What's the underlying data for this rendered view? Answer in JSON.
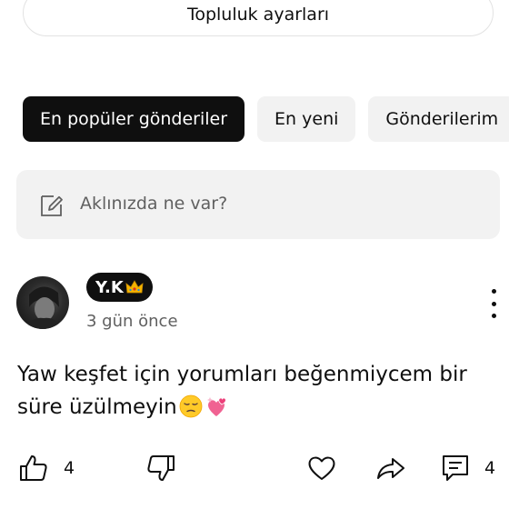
{
  "community_settings": {
    "label": "Topluluk ayarları"
  },
  "tabs": [
    {
      "label": "En popüler gönderiler",
      "active": true
    },
    {
      "label": "En yeni",
      "active": false
    },
    {
      "label": "Gönderilerim",
      "active": false
    }
  ],
  "composer": {
    "placeholder": "Aklınızda ne var?",
    "icon": "edit-icon"
  },
  "post": {
    "author": "Y.K",
    "author_badge_icon": "crown-emoji",
    "time": "3 gün önce",
    "text": "Yaw keşfet için yorumları beğenmiycem bir süre üzülmeyin",
    "emojis": [
      "pensive-face-emoji",
      "two-hearts-emoji"
    ],
    "like_count": "4",
    "comment_count": "4"
  },
  "colors": {
    "primary_text": "#0f0f0f",
    "secondary_text": "#606060",
    "chip_bg": "#f2f2f2",
    "active_chip_bg": "#0f0f0f"
  }
}
